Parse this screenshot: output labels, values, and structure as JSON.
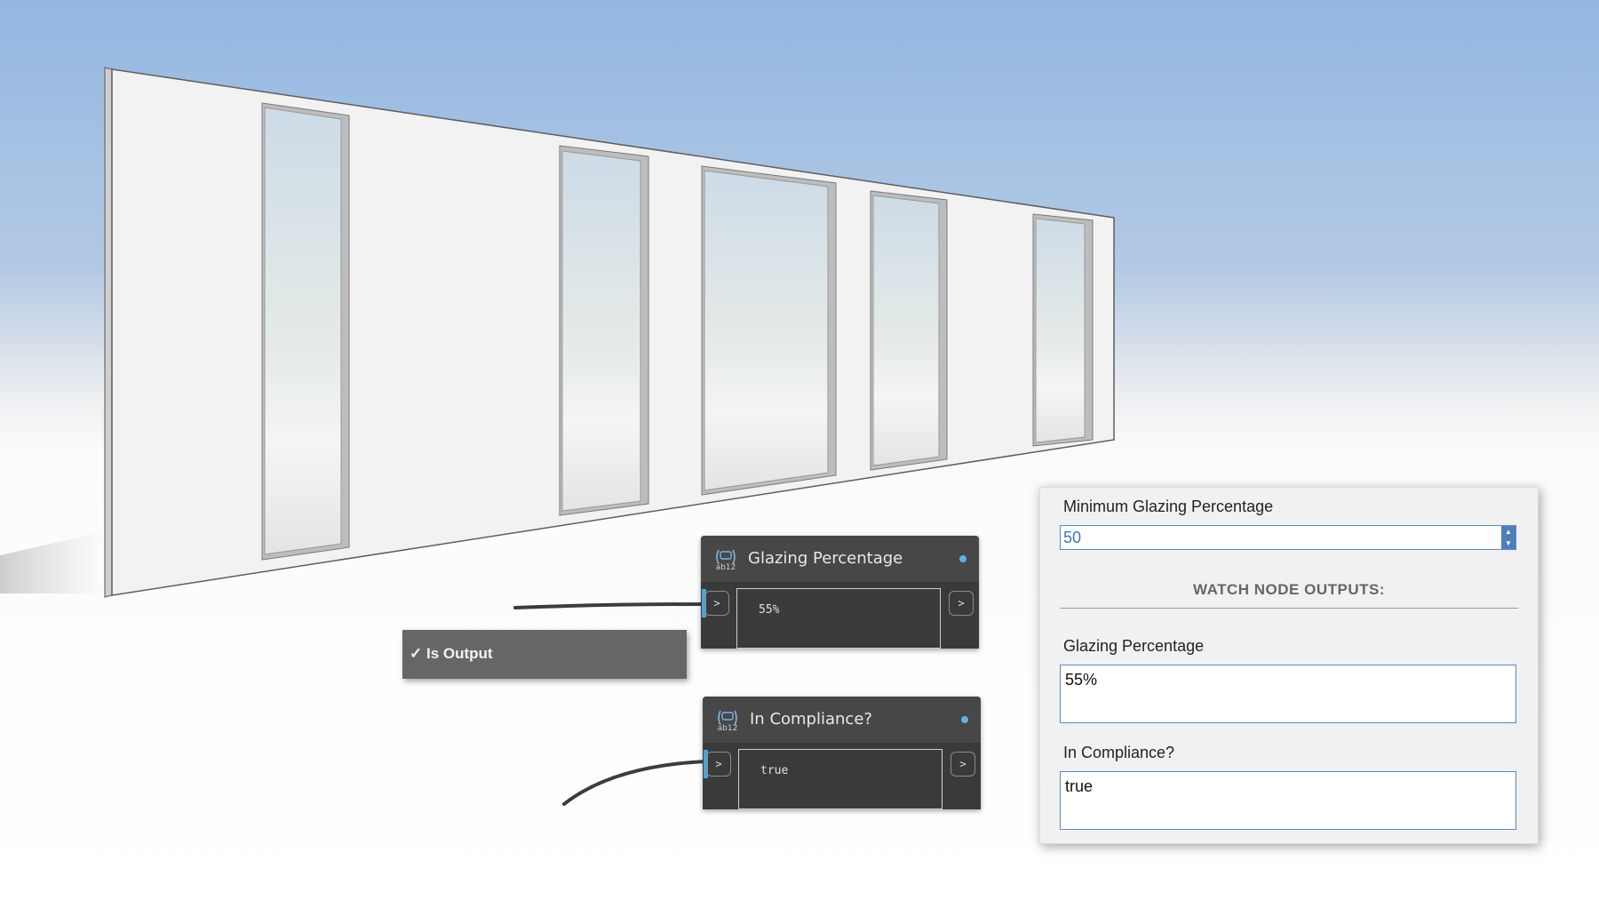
{
  "nodes": {
    "glazing": {
      "title": "Glazing Percentage",
      "value": "55%",
      "input_port": ">",
      "output_port": ">"
    },
    "compliance": {
      "title": "In Compliance?",
      "value": "true",
      "input_port": ">",
      "output_port": ">"
    }
  },
  "context_menu": {
    "item": "✓ Is Output"
  },
  "panel": {
    "min_glazing_label": "Minimum Glazing Percentage",
    "min_glazing_value": "50",
    "section_title": "WATCH NODE OUTPUTS:",
    "outputs": [
      {
        "label": "Glazing Percentage",
        "value": "55%"
      },
      {
        "label": "In Compliance?",
        "value": "true"
      }
    ]
  },
  "colors": {
    "sky_top": "#93b7e2",
    "node_body": "#3a3a3a",
    "node_header": "#474747",
    "port_accent": "#4fa3d9",
    "panel_bg": "#f1f1f1",
    "input_border": "#5a88c0"
  },
  "icons": {
    "node_icon": "watch-node-icon",
    "status_dot": "status-dot-icon",
    "spinner": "spinner-arrows-icon"
  }
}
